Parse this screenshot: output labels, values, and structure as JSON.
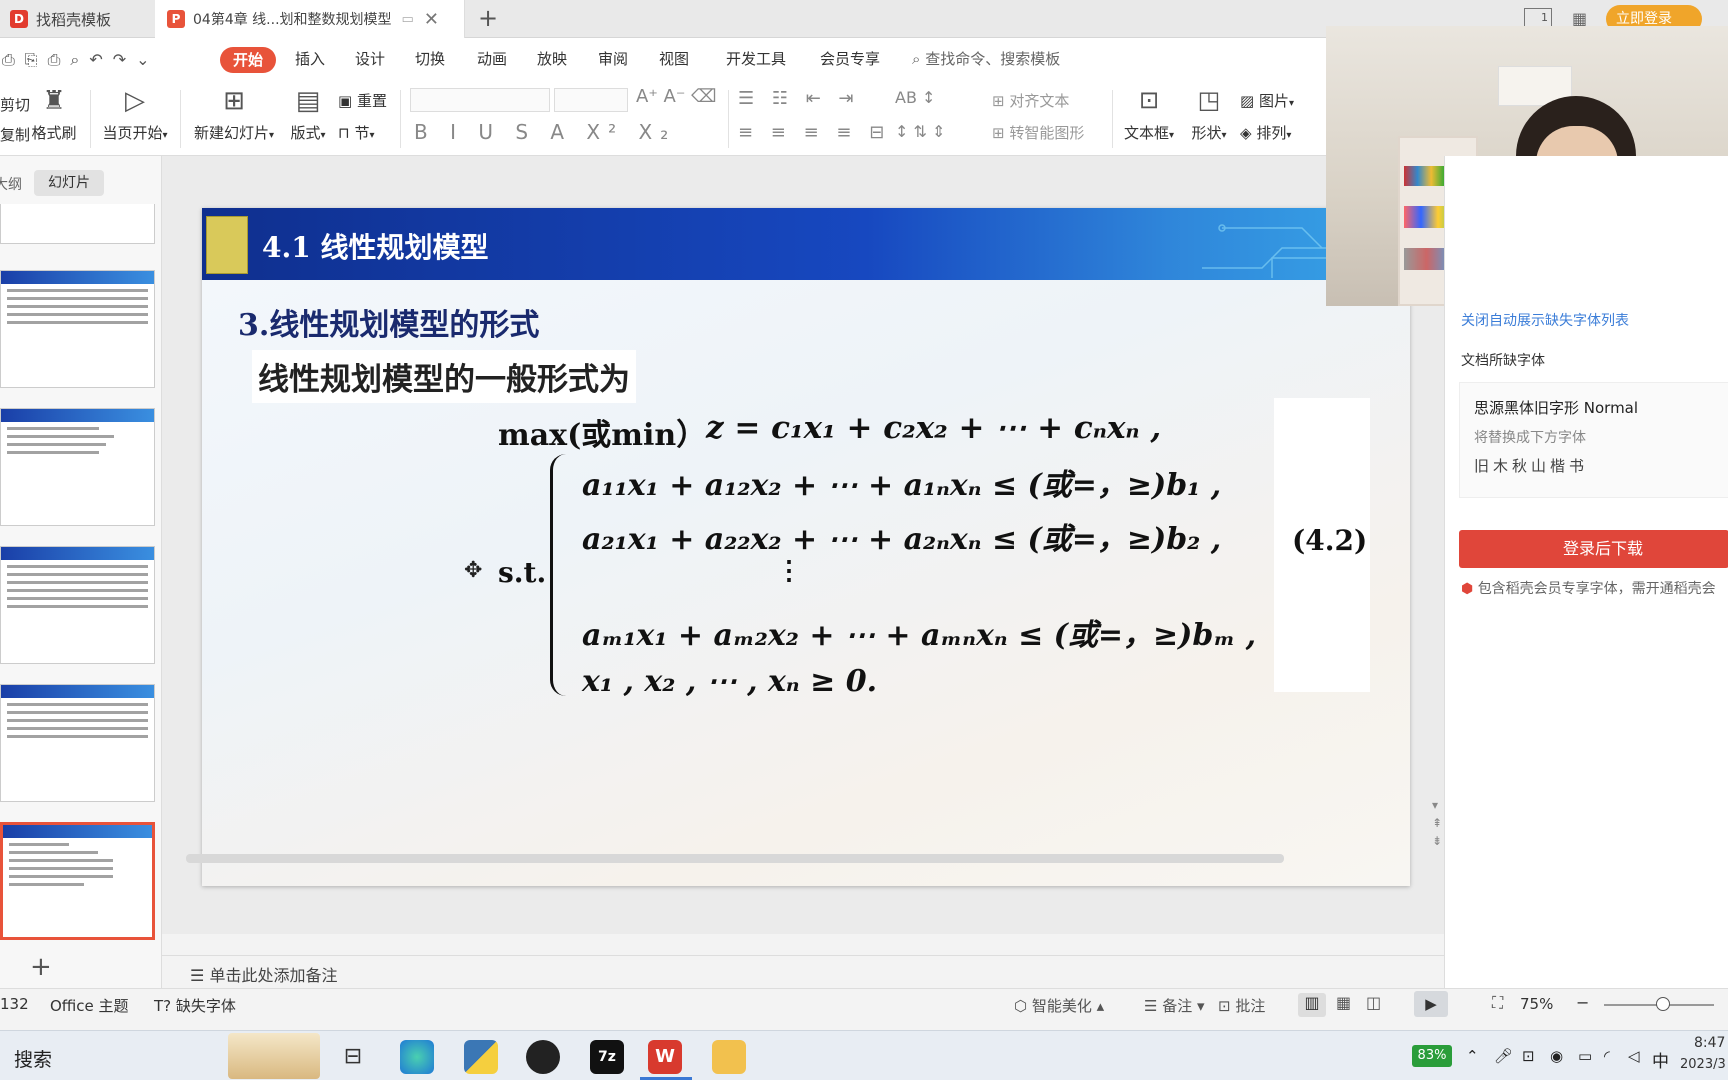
{
  "tabs": [
    {
      "label": "找稻壳模板"
    },
    {
      "label": "04第4章  线...划和整数规划模型"
    }
  ],
  "top_right": {
    "layout_label": "1",
    "login": "立即登录"
  },
  "menu": {
    "start": "开始",
    "items": [
      "插入",
      "设计",
      "切换",
      "动画",
      "放映",
      "审阅",
      "视图",
      "开发工具",
      "会员专享"
    ],
    "search_placeholder": "查找命令、搜索模板"
  },
  "ribbon": {
    "cut": "剪切",
    "copy": "复制",
    "format_painter": "格式刷",
    "play_from_current": "当页开始",
    "new_slide": "新建幻灯片",
    "layout": "版式",
    "reset": "重置",
    "section": "节",
    "align_text": "对齐文本",
    "convert_shape": "转智能图形",
    "textbox": "文本框",
    "shape": "形状",
    "picture": "图片",
    "arrange": "排列"
  },
  "left_panel": {
    "tab_outline": "大纲",
    "tab_slides": "幻灯片"
  },
  "slide": {
    "banner_title": "4.1 线性规划模型",
    "section_title": "3.线性规划模型的形式",
    "intro": "线性规划模型的一般形式为",
    "objective_prefix": "max(或min）",
    "objective": "z = c₁x₁ + c₂x₂ + ⋯ + cₙxₙ ,",
    "st_label": "s.t.",
    "constraints": [
      "a₁₁x₁ + a₁₂x₂ + ⋯ + a₁ₙxₙ ≤ (或=，≥)b₁ ,",
      "a₂₁x₁ + a₂₂x₂ + ⋯ + a₂ₙxₙ ≤ (或=，≥)b₂ ,",
      "⋮",
      "aₘ₁x₁ + aₘ₂x₂ + ⋯ + aₘₙxₙ ≤ (或=，≥)bₘ ,",
      "x₁ , x₂ , ⋯ , xₙ ≥ 0."
    ],
    "equation_number": "(4.2)"
  },
  "right_panel": {
    "close_link": "关闭自动展示缺失字体列表",
    "missing_fonts_heading": "文档所缺字体",
    "missing_font_name": "思源黑体旧字形 Normal",
    "replace_hint": "将替换成下方字体",
    "replacement_font": "旧木秋山楷书",
    "download_button": "登录后下载",
    "member_note": "包含稻壳会员专享字体，需开通稻壳会"
  },
  "notes_placeholder": "单击此处添加备注",
  "status": {
    "slide_count_fragment": "132",
    "theme": "Office 主题",
    "missing_font": "缺失字体",
    "beautify": "智能美化",
    "notes": "备注",
    "comments": "批注",
    "zoom": "75%"
  },
  "taskbar": {
    "search": "搜索",
    "battery": "83%",
    "ime": "中",
    "time": "8:47",
    "date": "2023/3"
  },
  "colors": {
    "accent_red": "#e8533a",
    "slide_banner": "#1748c0",
    "download_red": "#e0463a",
    "link_blue": "#3b7dd8"
  }
}
